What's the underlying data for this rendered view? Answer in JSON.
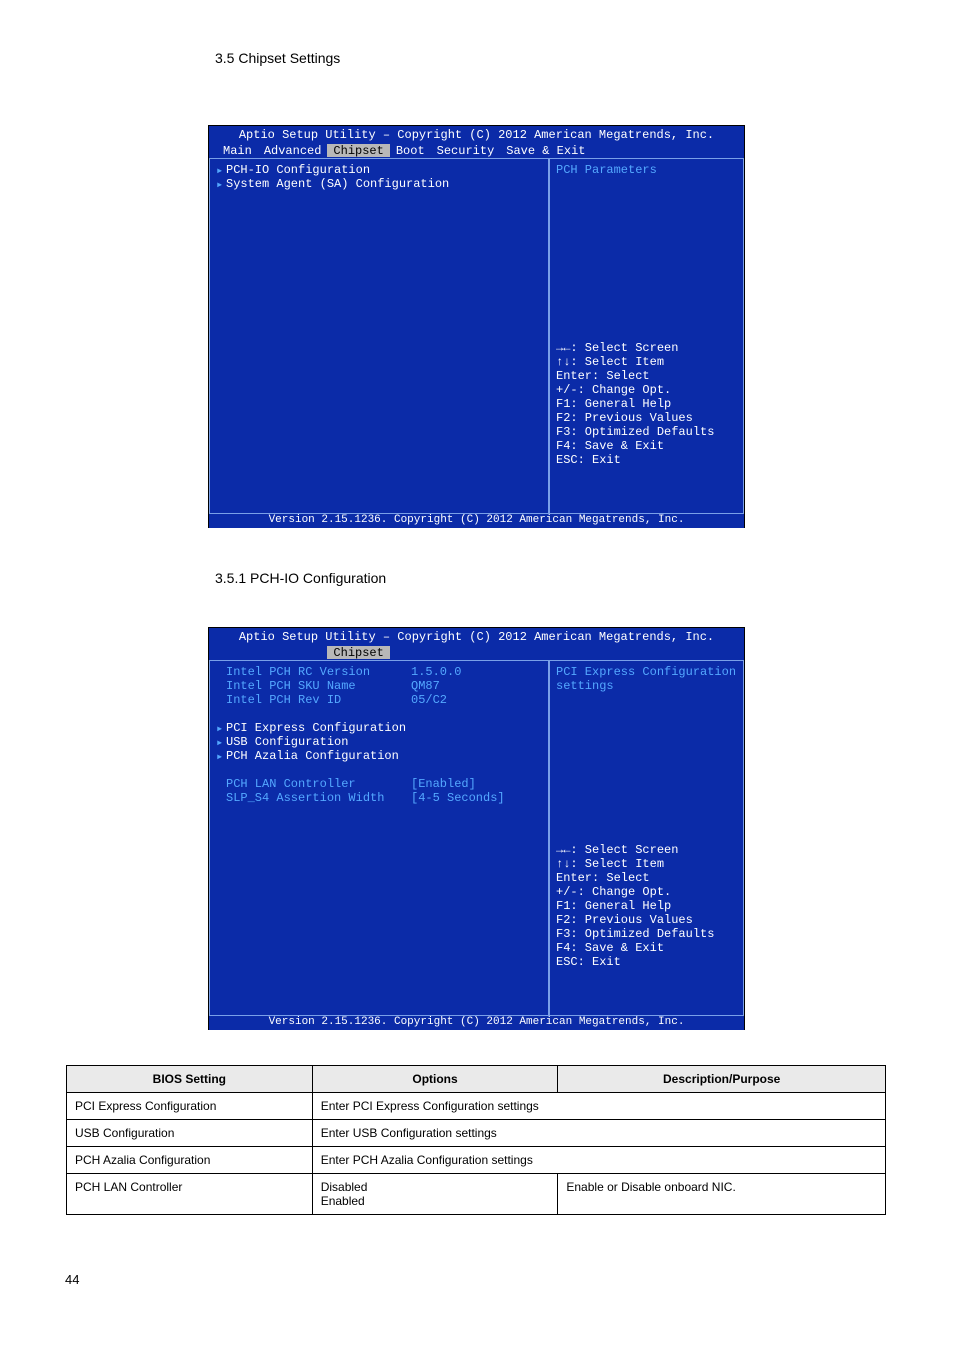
{
  "page": {
    "section1_title": "3.5 Chipset Settings",
    "section2_title": "3.5.1 PCH-IO Configuration",
    "page_number": "44"
  },
  "bios_common": {
    "header": "Aptio Setup Utility – Copyright (C) 2012 American Megatrends, Inc.",
    "footer": "Version 2.15.1236. Copyright (C) 2012 American Megatrends, Inc.",
    "tabs": [
      "Main",
      "Advanced",
      "Chipset",
      "Boot",
      "Security",
      "Save & Exit"
    ],
    "help_keys": [
      "→←: Select Screen",
      "↑↓: Select Item",
      "Enter: Select",
      "+/-: Change Opt.",
      "F1: General Help",
      "F2: Previous Values",
      "F3: Optimized Defaults",
      "F4: Save & Exit",
      "ESC: Exit"
    ]
  },
  "screen1": {
    "menu": [
      "PCH-IO Configuration",
      "System Agent (SA) Configuration"
    ],
    "help_top": "PCH Parameters"
  },
  "screen2": {
    "info": [
      {
        "label": "Intel PCH RC Version",
        "val": "1.5.0.0"
      },
      {
        "label": "Intel PCH SKU Name",
        "val": "QM87"
      },
      {
        "label": "Intel PCH Rev ID",
        "val": "05/C2"
      }
    ],
    "submenus": [
      "PCI Express Configuration",
      "USB Configuration",
      "PCH Azalia Configuration"
    ],
    "settings": [
      {
        "label": "PCH LAN Controller",
        "val": "[Enabled]"
      },
      {
        "label": "SLP_S4 Assertion Width",
        "val": "[4-5 Seconds]"
      }
    ],
    "help_top": "PCI Express Configuration settings"
  },
  "table": {
    "headers": [
      "BIOS Setting",
      "Options",
      "Description/Purpose"
    ],
    "rows": [
      {
        "c1": "PCI Express Configuration",
        "c2": "Enter",
        "c3": "PCI Express Configuration settings",
        "merged": false
      },
      {
        "c1": "USB Configuration",
        "c2": "Enter",
        "c3": "USB Configuration settings",
        "merged": false
      },
      {
        "c1": "PCH Azalia Configuration",
        "c2": "Enter",
        "c3": "PCH Azalia Configuration settings",
        "merged": false
      },
      {
        "c1": "PCH LAN Controller",
        "c2": "Disabled\nEnabled",
        "c3": "Enable or Disable onboard NIC.",
        "merged": false
      }
    ]
  }
}
